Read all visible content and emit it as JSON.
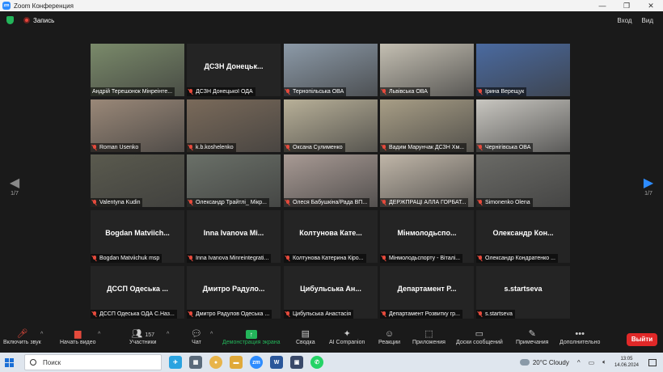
{
  "window": {
    "title": "Zoom Конференция",
    "min": "—",
    "max": "❐",
    "close": "✕"
  },
  "topbar": {
    "record": "Запись",
    "exit": "Вход",
    "view": "Вид"
  },
  "pager": {
    "left": "1/7",
    "right": "1/7"
  },
  "tiles": [
    {
      "label": "Андрій Терешонок Мінреінте...",
      "big": "",
      "muted": false,
      "active": true,
      "bg": "#7a8a6a"
    },
    {
      "label": "ДСЗН Донецької ОДА",
      "big": "ДСЗН Донецьк...",
      "muted": true,
      "active": false,
      "bg": ""
    },
    {
      "label": "Тернопільська ОВА",
      "big": "",
      "muted": true,
      "active": false,
      "bg": "#8c9aa8"
    },
    {
      "label": "Львівська ОВА",
      "big": "",
      "muted": true,
      "active": false,
      "bg": "#c4bfb2"
    },
    {
      "label": "Ірина Верещук",
      "big": "",
      "muted": true,
      "active": false,
      "bg": "#4a6aa0"
    },
    {
      "label": "Roman Usenko",
      "big": "",
      "muted": true,
      "active": false,
      "bg": "#9a8878"
    },
    {
      "label": "k.b.koshelenko",
      "big": "",
      "muted": true,
      "active": false,
      "bg": "#7a6a5a"
    },
    {
      "label": "Оксана Сулименко",
      "big": "",
      "muted": true,
      "active": false,
      "bg": "#b8b098"
    },
    {
      "label": "Вадим Марунчак ДСЗН Хм...",
      "big": "",
      "muted": true,
      "active": false,
      "bg": "#a89e86"
    },
    {
      "label": "Чернігівська ОВА",
      "big": "",
      "muted": true,
      "active": false,
      "bg": "#c8c6c0"
    },
    {
      "label": "Valentyna Kudin",
      "big": "",
      "muted": true,
      "active": false,
      "bg": "#5a5a4e"
    },
    {
      "label": "Олександр Трайтлі_ Мікр...",
      "big": "",
      "muted": true,
      "active": false,
      "bg": "#6a7068"
    },
    {
      "label": "Олеся Бабушкіна/Рада ВП...",
      "big": "",
      "muted": true,
      "active": false,
      "bg": "#a89a94"
    },
    {
      "label": "ДЕРЖПРАЦІ АЛЛА ГОРБАТ...",
      "big": "",
      "muted": true,
      "active": false,
      "bg": "#c0b6a8"
    },
    {
      "label": "Simonenko Olena",
      "big": "",
      "muted": true,
      "active": false,
      "bg": "#6a6a66"
    },
    {
      "label": "Bogdan Matviichuk msp",
      "big": "Bogdan Matviich...",
      "muted": true,
      "active": false,
      "bg": ""
    },
    {
      "label": "Inna Ivanova Minreintegrati...",
      "big": "Inna Ivanova Mi...",
      "muted": true,
      "active": false,
      "bg": ""
    },
    {
      "label": "Колтунова Катерина Кіро...",
      "big": "Колтунова Кате...",
      "muted": true,
      "active": false,
      "bg": ""
    },
    {
      "label": "Мінмолодьспорту - Віталі...",
      "big": "Мінмолодьспо...",
      "muted": true,
      "active": false,
      "bg": ""
    },
    {
      "label": "Олександр Кондратенко ...",
      "big": "Олександр Кон...",
      "muted": true,
      "active": false,
      "bg": ""
    },
    {
      "label": "ДССП Одеська ОДА С.Наз...",
      "big": "ДССП Одеська ...",
      "muted": true,
      "active": false,
      "bg": ""
    },
    {
      "label": "Дмитро Радулов Одеська ...",
      "big": "Дмитро Радуло...",
      "muted": true,
      "active": false,
      "bg": ""
    },
    {
      "label": "Цибульська Анастасія",
      "big": "Цибульська Ан...",
      "muted": true,
      "active": false,
      "bg": ""
    },
    {
      "label": "Департамент Розвитку гр...",
      "big": "Департамент Р...",
      "muted": true,
      "active": false,
      "bg": ""
    },
    {
      "label": "s.startseva",
      "big": "s.startseva",
      "muted": true,
      "active": false,
      "bg": ""
    }
  ],
  "toolbar": {
    "audio": "Включить звук",
    "video": "Начать видео",
    "participants": "Участники",
    "participants_count": "157",
    "chat": "Чат",
    "share": "Демонстрация экрана",
    "summary": "Сводка",
    "ai": "AI Companion",
    "reactions": "Реакции",
    "apps": "Приложения",
    "whiteboards": "Доски сообщений",
    "notes": "Примечания",
    "more": "Дополнительно",
    "leave": "Выйти"
  },
  "taskbar": {
    "search": "Поиск",
    "weather": "20°C  Cloudy",
    "time": "13:05",
    "date": "14.06.2024"
  }
}
